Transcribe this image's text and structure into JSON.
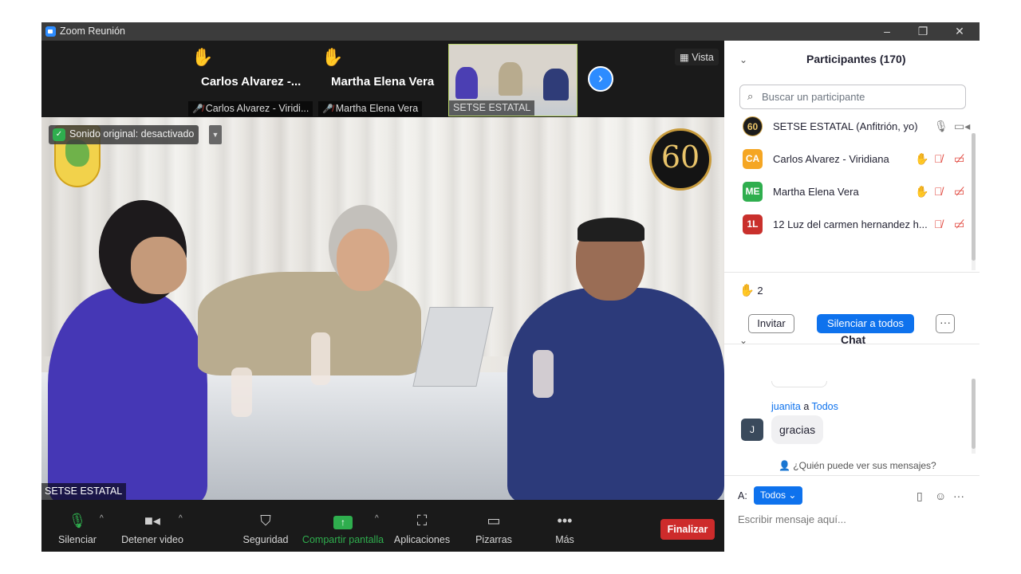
{
  "window": {
    "title": "Zoom Reunión",
    "controls": [
      "–",
      "❐",
      "✕"
    ]
  },
  "strip": {
    "tiles": [
      {
        "big_name": "Carlos Alvarez -...",
        "label": "Carlos Alvarez - Viridi...",
        "hand": "✋"
      },
      {
        "big_name": "Martha Elena Vera",
        "label": "Martha Elena Vera",
        "hand": "✋"
      },
      {
        "big_name": "",
        "label": "SETSE ESTATAL",
        "hand": ""
      }
    ],
    "next_arrow": "›",
    "view_label": "Vista"
  },
  "main_video": {
    "sound_notice": "Sonido original: desactivado",
    "speaker_label": "SETSE ESTATAL",
    "anniversary_logo_text": "60"
  },
  "toolbar": {
    "mute": "Silenciar",
    "stop_video": "Detener video",
    "security": "Seguridad",
    "share_screen": "Compartir pantalla",
    "apps": "Aplicaciones",
    "whiteboards": "Pizarras",
    "more": "Más",
    "end": "Finalizar"
  },
  "participants": {
    "title": "Participantes (170)",
    "search_placeholder": "Buscar un participante",
    "list": [
      {
        "initials": "60",
        "name": "SETSE ESTATAL (Anfitrión, yo)",
        "color": "#1c1c1c"
      },
      {
        "initials": "CA",
        "name": "Carlos Alvarez - Viridiana",
        "color": "#f5a623"
      },
      {
        "initials": "ME",
        "name": "Martha Elena Vera",
        "color": "#2fae4e"
      },
      {
        "initials": "1L",
        "name": "12 Luz del carmen hernandez h...",
        "color": "#c9302c"
      }
    ],
    "raised_hands_count": "2",
    "invite": "Invitar",
    "mute_all": "Silenciar a todos",
    "more": "···"
  },
  "chat": {
    "title": "Chat",
    "sender": "juanita",
    "to_word": "a",
    "recipient": "Todos",
    "avatar_initial": "J",
    "message": "gracias",
    "who_can_see": "¿Quién puede ver sus mensajes?",
    "to_label": "A:",
    "to_select": "Todos",
    "input_placeholder": "Escribir mensaje aquí..."
  },
  "colors": {
    "accent": "#0e72ed",
    "end_red": "#cd2b2b",
    "share_green": "#2fae4e"
  }
}
